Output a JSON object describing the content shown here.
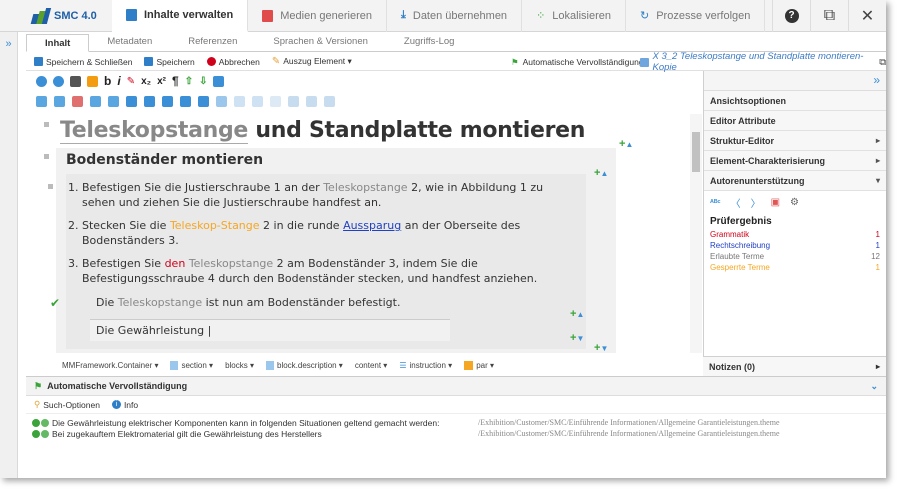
{
  "app": {
    "name": "SMC 4.0"
  },
  "top_tabs": [
    {
      "label": "Inhalte verwalten",
      "active": true,
      "icon": "book-icon"
    },
    {
      "label": "Medien generieren",
      "active": false,
      "icon": "media-icon"
    },
    {
      "label": "Daten übernehmen",
      "active": false,
      "icon": "download-icon"
    },
    {
      "label": "Lokalisieren",
      "active": false,
      "icon": "localize-icon"
    },
    {
      "label": "Prozesse verfolgen",
      "active": false,
      "icon": "process-icon"
    }
  ],
  "top_right": {
    "help": "?",
    "window": "⧉",
    "close": "✕"
  },
  "left_strip": {
    "expand": "»"
  },
  "sub_tabs": [
    "Inhalt",
    "Metadaten",
    "Referenzen",
    "Sprachen & Versionen",
    "Zugriffs-Log"
  ],
  "actions": {
    "save_close": "Speichern & Schließen",
    "save": "Speichern",
    "cancel": "Abbrechen",
    "excerpt": "Auszug Element ▾",
    "autocomplete": "Automatische Vervollständigung",
    "doc_link": "X 3_2 Teleskopstange und Standplatte montieren-Kopie"
  },
  "right_panel": {
    "expand": "»",
    "items": [
      {
        "label": "Ansichtsoptionen",
        "chev": ""
      },
      {
        "label": "Editor Attribute",
        "chev": ""
      },
      {
        "label": "Struktur-Editor",
        "chev": "▸"
      },
      {
        "label": "Element-Charakterisierung",
        "chev": "▸"
      },
      {
        "label": "Autorenunterstützung",
        "chev": "▾"
      }
    ],
    "pruef": {
      "title": "Prüfergebnis",
      "rows": [
        {
          "label": "Grammatik",
          "value": "1",
          "color": "#d0021b"
        },
        {
          "label": "Rechtschreibung",
          "value": "1",
          "color": "#2140c4"
        },
        {
          "label": "Erlaubte Terme",
          "value": "12",
          "color": "#777777"
        },
        {
          "label": "Gesperrte Terme",
          "value": "1",
          "color": "#f5a623"
        }
      ]
    },
    "notes": "Notizen (0)"
  },
  "editor": {
    "title_term": "Teleskopstange",
    "title_rest": " und Standplatte montieren",
    "section": "Bodenständer montieren",
    "steps": [
      {
        "n": "1.",
        "a": "Befestigen Sie die Justierschraube 1 an der ",
        "term": "Teleskopstange",
        "b": " 2, wie in Abbildung 1 zu sehen und ziehen Sie die Justierschraube handfest an."
      },
      {
        "n": "2.",
        "a": "Stecken Sie die ",
        "term": "Teleskop-Stange",
        "b": " 2 in die runde ",
        "term2": "Aussparug",
        "c": " an der Oberseite des Bodenständers 3."
      },
      {
        "n": "3.",
        "a": "Befestigen Sie ",
        "term": "den",
        "b": " ",
        "term2": "Teleskopstange",
        "c": " 2 am Bodenständer 3, indem Sie die Befestigungsschraube 4 durch den Bodenständer stecken, und handfest anziehen."
      }
    ],
    "result_a": "Die ",
    "result_term": "Teleskopstange",
    "result_b": " ist nun am Bodenständer befestigt.",
    "warranty": "Die Gewährleistung"
  },
  "crumbs": [
    "MMFramework.Container ▾",
    "section ▾",
    "blocks ▾",
    "block.description ▾",
    "content ▾",
    "instruction ▾",
    "par ▾"
  ],
  "bottom": {
    "title": "Automatische Vervollständigung",
    "search_options": "Such-Optionen",
    "info": "Info",
    "items": [
      {
        "text": "Die Gewährleistung elektrischer Komponenten kann in folgenden Situationen geltend gemacht werden:",
        "path": "/Exhibition/Customer/SMC/Einführende Informationen/Allgemeine Garantieleistungen.theme"
      },
      {
        "text": "Bei zugekauftem Elektromaterial gilt die Gewährleistung des Herstellers",
        "path": "/Exhibition/Customer/SMC/Einführende Informationen/Allgemeine Garantieleistungen.theme"
      }
    ]
  }
}
